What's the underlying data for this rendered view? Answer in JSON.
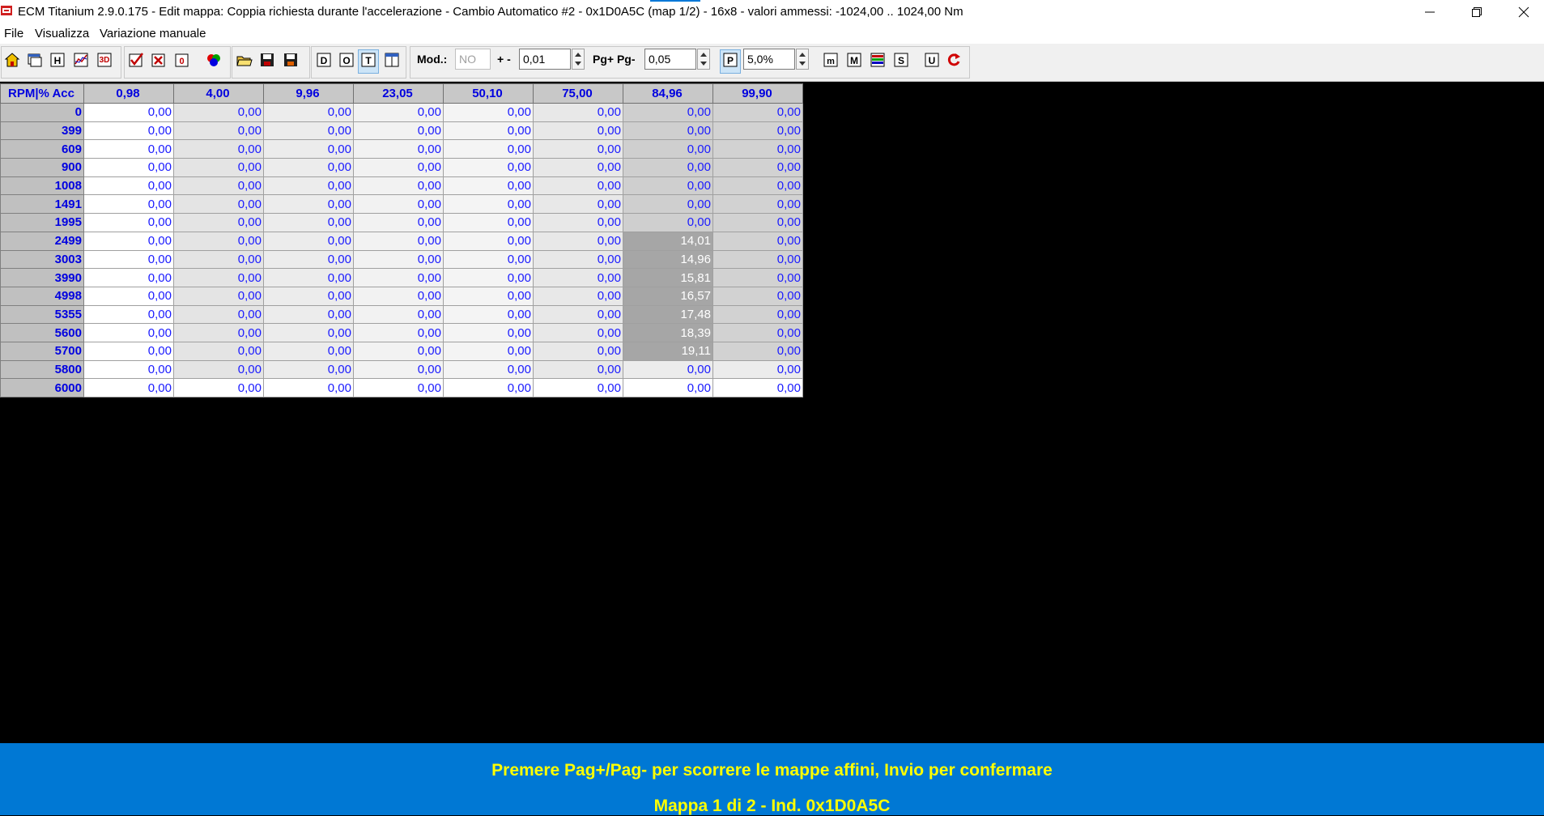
{
  "window": {
    "title": "ECM Titanium 2.9.0.175 - Edit mappa: Coppia richiesta durante l'accelerazione - Cambio Automatico #2 - 0x1D0A5C (map 1/2) - 16x8 - valori ammessi: -1024,00 .. 1024,00 Nm"
  },
  "menu": [
    "File",
    "Visualizza",
    "Variazione manuale"
  ],
  "toolbar": {
    "mod_label": "Mod.:",
    "mod_value": "NO",
    "plusminus_label": "+ -",
    "step_value": "0,01",
    "page_label": "Pg+ Pg-",
    "page_step_value": "0,05",
    "percent_value": "5,0%",
    "icons": [
      "home-icon",
      "window-icon",
      "h-icon",
      "chart-icon",
      "3d-icon",
      "check-icon",
      "x-check-icon",
      "zero-icon",
      "colors-icon",
      "open-folder-icon",
      "save-icon",
      "save-as-icon",
      "d-icon",
      "o-icon",
      "t-icon",
      "columns-icon",
      "p-icon",
      "m-small-icon",
      "m-icon",
      "stripe-icon",
      "s-icon",
      "u-icon",
      "refresh-icon"
    ]
  },
  "table": {
    "corner": "RPM|% Acc",
    "columns": [
      "0,98",
      "4,00",
      "9,96",
      "23,05",
      "50,10",
      "75,00",
      "84,96",
      "99,90"
    ],
    "rows": [
      {
        "rpm": "0",
        "values": [
          "0,00",
          "0,00",
          "0,00",
          "0,00",
          "0,00",
          "0,00",
          "0,00",
          "0,00"
        ]
      },
      {
        "rpm": "399",
        "values": [
          "0,00",
          "0,00",
          "0,00",
          "0,00",
          "0,00",
          "0,00",
          "0,00",
          "0,00"
        ]
      },
      {
        "rpm": "609",
        "values": [
          "0,00",
          "0,00",
          "0,00",
          "0,00",
          "0,00",
          "0,00",
          "0,00",
          "0,00"
        ]
      },
      {
        "rpm": "900",
        "values": [
          "0,00",
          "0,00",
          "0,00",
          "0,00",
          "0,00",
          "0,00",
          "0,00",
          "0,00"
        ]
      },
      {
        "rpm": "1008",
        "values": [
          "0,00",
          "0,00",
          "0,00",
          "0,00",
          "0,00",
          "0,00",
          "0,00",
          "0,00"
        ]
      },
      {
        "rpm": "1491",
        "values": [
          "0,00",
          "0,00",
          "0,00",
          "0,00",
          "0,00",
          "0,00",
          "0,00",
          "0,00"
        ]
      },
      {
        "rpm": "1995",
        "values": [
          "0,00",
          "0,00",
          "0,00",
          "0,00",
          "0,00",
          "0,00",
          "0,00",
          "0,00"
        ]
      },
      {
        "rpm": "2499",
        "values": [
          "0,00",
          "0,00",
          "0,00",
          "0,00",
          "0,00",
          "0,00",
          "14,01",
          "0,00"
        ]
      },
      {
        "rpm": "3003",
        "values": [
          "0,00",
          "0,00",
          "0,00",
          "0,00",
          "0,00",
          "0,00",
          "14,96",
          "0,00"
        ]
      },
      {
        "rpm": "3990",
        "values": [
          "0,00",
          "0,00",
          "0,00",
          "0,00",
          "0,00",
          "0,00",
          "15,81",
          "0,00"
        ]
      },
      {
        "rpm": "4998",
        "values": [
          "0,00",
          "0,00",
          "0,00",
          "0,00",
          "0,00",
          "0,00",
          "16,57",
          "0,00"
        ]
      },
      {
        "rpm": "5355",
        "values": [
          "0,00",
          "0,00",
          "0,00",
          "0,00",
          "0,00",
          "0,00",
          "17,48",
          "0,00"
        ]
      },
      {
        "rpm": "5600",
        "values": [
          "0,00",
          "0,00",
          "0,00",
          "0,00",
          "0,00",
          "0,00",
          "18,39",
          "0,00"
        ]
      },
      {
        "rpm": "5700",
        "values": [
          "0,00",
          "0,00",
          "0,00",
          "0,00",
          "0,00",
          "0,00",
          "19,11",
          "0,00"
        ]
      },
      {
        "rpm": "5800",
        "values": [
          "0,00",
          "0,00",
          "0,00",
          "0,00",
          "0,00",
          "0,00",
          "0,00",
          "0,00"
        ]
      },
      {
        "rpm": "6000",
        "values": [
          "0,00",
          "0,00",
          "0,00",
          "0,00",
          "0,00",
          "0,00",
          "0,00",
          "0,00"
        ]
      }
    ]
  },
  "status": {
    "line1": "Premere Pag+/Pag- per scorrere le mappe affini, Invio per confermare",
    "line2": "Mappa 1 di 2 - Ind. 0x1D0A5C"
  },
  "colors": {
    "status_bg": "#0078d4",
    "status_text": "#ffff00",
    "value_text": "#1a1aff",
    "highlight_cell": "#a6a6a6",
    "highlight_text": "#ffffff"
  }
}
